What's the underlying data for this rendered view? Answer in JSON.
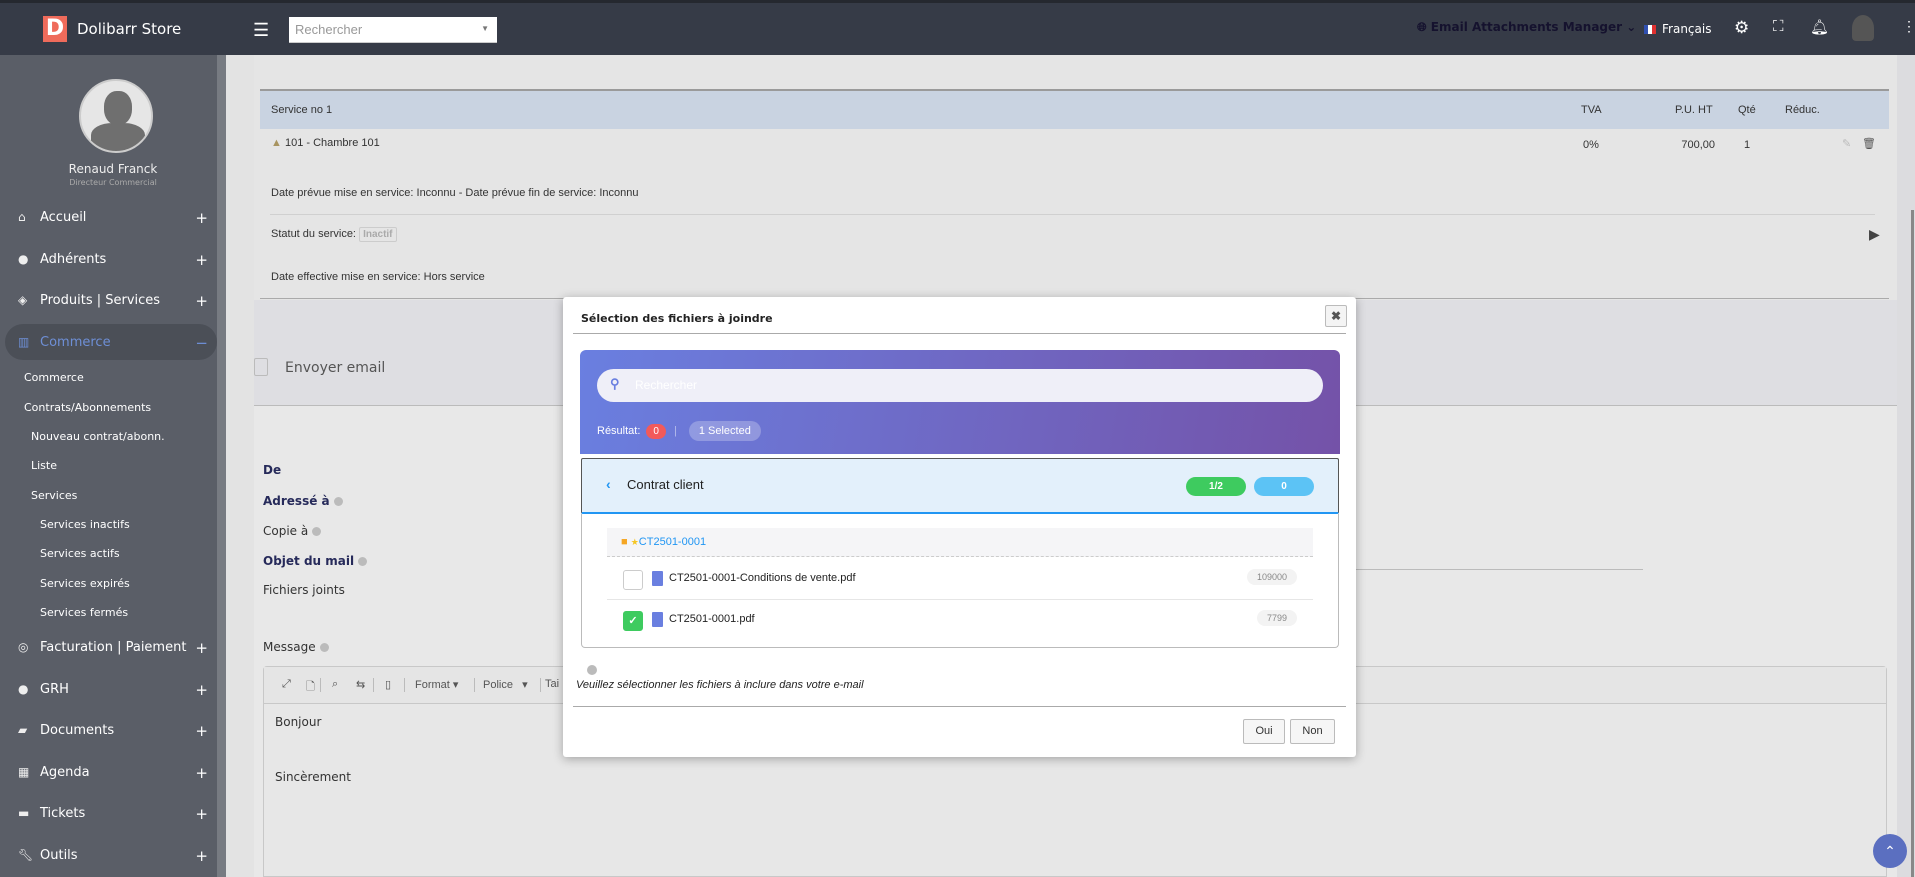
{
  "topbar": {
    "logo_letter": "D",
    "brand": "Dolibarr Store",
    "search_placeholder": "Rechercher",
    "module": "Email Attachments Manager",
    "language": "Français"
  },
  "user": {
    "name": "Renaud Franck",
    "role": "Directeur Commercial"
  },
  "sidebar": {
    "items": [
      {
        "label": "Accueil",
        "toggle": "+"
      },
      {
        "label": "Adhérents",
        "toggle": "+"
      },
      {
        "label": "Produits | Services",
        "toggle": "+"
      },
      {
        "label": "Commerce",
        "toggle": "−"
      },
      {
        "label": "Facturation | Paiement",
        "toggle": "+"
      },
      {
        "label": "GRH",
        "toggle": "+"
      },
      {
        "label": "Documents",
        "toggle": "+"
      },
      {
        "label": "Agenda",
        "toggle": "+"
      },
      {
        "label": "Tickets",
        "toggle": "+"
      },
      {
        "label": "Outils",
        "toggle": "+"
      }
    ],
    "sub": [
      "Commerce",
      "Contrats/Abonnements",
      "Nouveau contrat/abonn.",
      "Liste",
      "Services",
      "Services inactifs",
      "Services actifs",
      "Services expirés",
      "Services fermés"
    ]
  },
  "service": {
    "header": "Service no 1",
    "cols": {
      "tva": "TVA",
      "pu": "P.U. HT",
      "qte": "Qté",
      "reduc": "Réduc."
    },
    "line": {
      "label": "101 - Chambre 101",
      "tva": "0%",
      "pu": "700,00",
      "qte": "1"
    },
    "dates": "Date prévue mise en service: Inconnu  -  Date prévue fin de service: Inconnu",
    "status_label": "Statut du service:",
    "status": "Inactif",
    "effective": "Date effective mise en service: Hors service"
  },
  "email": {
    "title": "Envoyer email",
    "from": "De",
    "to": "Adressé à",
    "cc": "Copie à",
    "subject": "Objet du mail",
    "files": "Fichiers joints",
    "message": "Message",
    "toolbar": {
      "format": "Format",
      "font": "Police",
      "size": "Tai"
    },
    "body": [
      "Bonjour",
      "Sincèrement"
    ]
  },
  "modal": {
    "title": "Sélection des fichiers à joindre",
    "close": "✖",
    "search_placeholder": "Rechercher",
    "result_label": "Résultat:",
    "result_count": "0",
    "selected": "1 Selected",
    "folder": {
      "name": "Contrat client",
      "count": "1/2",
      "other": "0",
      "subfolder": "CT2501-0001"
    },
    "files": [
      {
        "name": "CT2501-0001-Conditions de vente.pdf",
        "size": "109000",
        "checked": false
      },
      {
        "name": "CT2501-0001.pdf",
        "size": "7799",
        "checked": true
      }
    ],
    "help": "Veuillez sélectionner les fichiers à inclure dans votre e-mail",
    "yes": "Oui",
    "no": "Non"
  }
}
